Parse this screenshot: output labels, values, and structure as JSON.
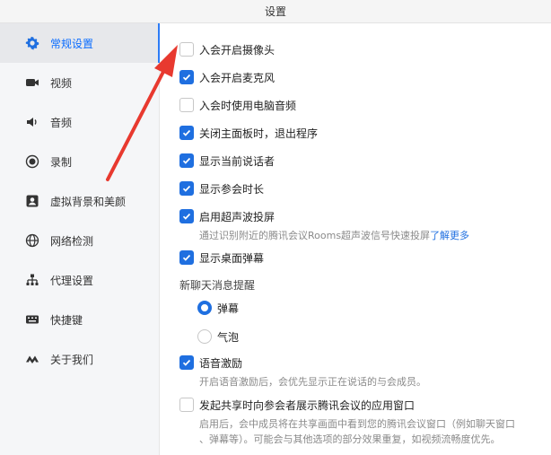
{
  "window": {
    "title": "设置"
  },
  "sidebar": {
    "items": [
      {
        "label": "常规设置",
        "icon": "gear-icon",
        "active": true
      },
      {
        "label": "视频",
        "icon": "video-camera-icon",
        "active": false
      },
      {
        "label": "音频",
        "icon": "speaker-icon",
        "active": false
      },
      {
        "label": "录制",
        "icon": "record-icon",
        "active": false
      },
      {
        "label": "虚拟背景和美颜",
        "icon": "portrait-icon",
        "active": false
      },
      {
        "label": "网络检测",
        "icon": "globe-icon",
        "active": false
      },
      {
        "label": "代理设置",
        "icon": "network-tree-icon",
        "active": false
      },
      {
        "label": "快捷键",
        "icon": "keyboard-icon",
        "active": false
      },
      {
        "label": "关于我们",
        "icon": "logo-icon",
        "active": false
      }
    ]
  },
  "settings": {
    "camera_on_join": {
      "label": "入会开启摄像头",
      "checked": false
    },
    "mic_on_join": {
      "label": "入会开启麦克风",
      "checked": true
    },
    "computer_audio": {
      "label": "入会时使用电脑音频",
      "checked": false
    },
    "exit_on_close": {
      "label": "关闭主面板时，退出程序",
      "checked": true
    },
    "show_speaker": {
      "label": "显示当前说话者",
      "checked": true
    },
    "show_duration": {
      "label": "显示参会时长",
      "checked": true
    },
    "ultrasonic": {
      "label": "启用超声波投屏",
      "checked": true,
      "description": "通过识别附近的腾讯会议Rooms超声波信号快速投屏",
      "link": "了解更多"
    },
    "desktop_danmaku": {
      "label": "显示桌面弹幕",
      "checked": true
    },
    "chat_alert": {
      "section_label": "新聊天消息提醒",
      "options": [
        {
          "label": "弹幕",
          "selected": true
        },
        {
          "label": "气泡",
          "selected": false
        }
      ]
    },
    "voice_motivation": {
      "label": "语音激励",
      "checked": true,
      "description": "开启语音激励后，会优先显示正在说话的与会成员。"
    },
    "share_app_window": {
      "label": "发起共享时向参会者展示腾讯会议的应用窗口",
      "checked": false,
      "description_line1": "启用后，会中成员将在共享画面中看到您的腾讯会议窗口（例如聊天窗口",
      "description_line2": "、弹幕等）。可能会与其他选项的部分效果重复，如视频流畅度优先。"
    }
  },
  "colors": {
    "accent": "#1f6fe0",
    "annotation_arrow": "#e8392f"
  }
}
